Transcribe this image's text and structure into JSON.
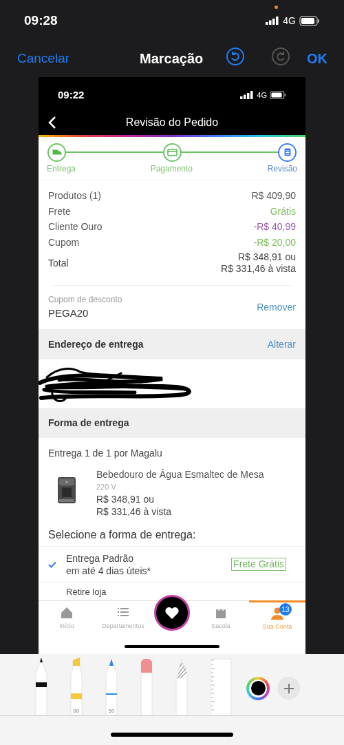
{
  "status_bar": {
    "time": "09:28",
    "network": "4G"
  },
  "markup_bar": {
    "cancel": "Cancelar",
    "title": "Marcação",
    "done": "OK",
    "undo_enabled": true,
    "redo_enabled": false
  },
  "screenshot": {
    "status_bar": {
      "time": "09:22",
      "network": "4G"
    },
    "header": {
      "title": "Revisão do Pedido"
    },
    "steps": [
      {
        "label": "Entrega",
        "selected": false
      },
      {
        "label": "Pagamento",
        "selected": false
      },
      {
        "label": "Revisão",
        "selected": true
      }
    ],
    "summary": [
      {
        "label": "Produtos (1)",
        "value": "R$ 409,90",
        "color": "#555555"
      },
      {
        "label": "Frete",
        "value": "Grátis",
        "color": "#7cbf5a"
      },
      {
        "label": "Cliente Ouro",
        "value": "-R$ 40,99",
        "color": "#9b59a8"
      },
      {
        "label": "Cupom",
        "value": "-R$ 20,00",
        "color": "#7cbf5a"
      }
    ],
    "total": {
      "label": "Total",
      "value": [
        "R$ 348,91 ou",
        "R$ 331,46 à vista"
      ]
    },
    "coupon": {
      "label": "Cupom de desconto",
      "code": "PEGA20",
      "action": "Remover"
    },
    "address": {
      "heading": "Endereço de entrega",
      "action": "Alterar"
    },
    "delivery": {
      "heading": "Forma de entrega",
      "shipment": "Entrega 1 de 1 por Magalu",
      "product": {
        "name": "Bebedouro de Água Esmaltec de Mesa",
        "variant": "220 V",
        "price": [
          "R$ 348,91 ou",
          "R$ 331,46 à vista"
        ]
      },
      "prompt": "Selecione a forma de entrega:",
      "options": [
        {
          "name": "Entrega Padrão",
          "detail": "em até 4 dias úteis*",
          "badge": "Frete Grátis",
          "selected": true
        },
        {
          "name": "Retire loja",
          "selected": false
        }
      ]
    },
    "tab_bar": [
      {
        "kind": "home",
        "label": "Início",
        "selected": false
      },
      {
        "kind": "list",
        "label": "Departamentos",
        "selected": false
      },
      {
        "kind": "center"
      },
      {
        "kind": "bag",
        "label": "Sacola",
        "selected": false
      },
      {
        "kind": "account",
        "label": "Sua Conta",
        "selected": true,
        "badge": "13"
      }
    ]
  },
  "tools": [
    {
      "kind": "pen"
    },
    {
      "kind": "marker",
      "label": "80"
    },
    {
      "kind": "pencil",
      "label": "50"
    },
    {
      "kind": "eraser"
    },
    {
      "kind": "lasso"
    },
    {
      "kind": "ruler"
    },
    {
      "kind": "color"
    },
    {
      "kind": "add"
    }
  ]
}
